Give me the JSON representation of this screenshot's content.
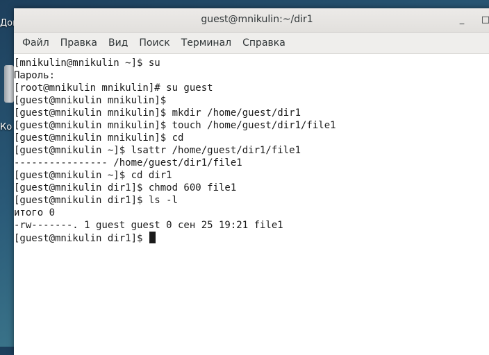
{
  "desktop": {
    "icon_label_1": "Дома",
    "icon_label_2": "Ко"
  },
  "window": {
    "title": "guest@mnikulin:~/dir1",
    "minimize_glyph": "_",
    "maximize_glyph": "□"
  },
  "menu": {
    "items": [
      "Файл",
      "Правка",
      "Вид",
      "Поиск",
      "Терминал",
      "Справка"
    ]
  },
  "terminal": {
    "lines": [
      "[mnikulin@mnikulin ~]$ su",
      "Пароль:",
      "[root@mnikulin mnikulin]# su guest",
      "[guest@mnikulin mnikulin]$",
      "[guest@mnikulin mnikulin]$ mkdir /home/guest/dir1",
      "[guest@mnikulin mnikulin]$ touch /home/guest/dir1/file1",
      "[guest@mnikulin mnikulin]$ cd",
      "[guest@mnikulin ~]$ lsattr /home/guest/dir1/file1",
      "---------------- /home/guest/dir1/file1",
      "[guest@mnikulin ~]$ cd dir1",
      "[guest@mnikulin dir1]$ chmod 600 file1",
      "[guest@mnikulin dir1]$ ls -l",
      "итого 0",
      "-rw-------. 1 guest guest 0 сен 25 19:21 file1"
    ],
    "prompt": "[guest@mnikulin dir1]$ "
  }
}
